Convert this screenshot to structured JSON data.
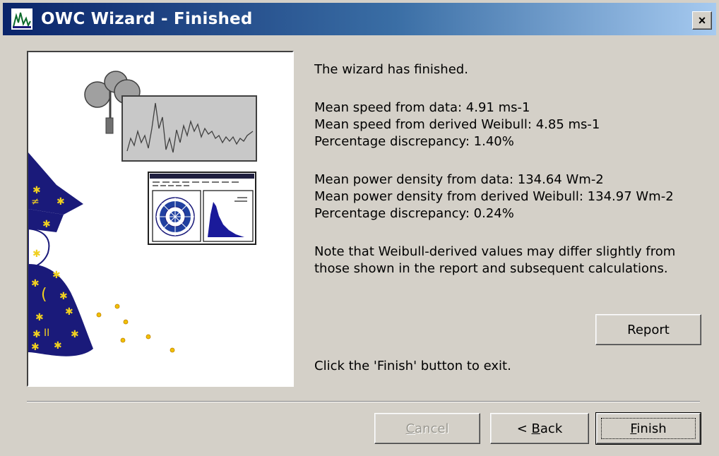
{
  "window": {
    "title": "OWC Wizard - Finished",
    "close_label": "×"
  },
  "content": {
    "intro": "The wizard has finished.",
    "speed_data": "Mean speed from data: 4.91 ms-1",
    "speed_weibull": "Mean speed from derived Weibull: 4.85 ms-1",
    "speed_discrepancy": "Percentage discrepancy: 1.40%",
    "power_data": "Mean power density from data: 134.64 Wm-2",
    "power_weibull": "Mean power density from derived Weibull: 134.97 Wm-2",
    "power_discrepancy": "Percentage discrepancy: 0.24%",
    "note_line1": "Note that Weibull-derived values may differ slightly from",
    "note_line2": "those shown in the report and subsequent calculations.",
    "finish_hint": "Click the 'Finish' button to exit."
  },
  "buttons": {
    "report": "Report",
    "cancel_accel": "C",
    "cancel_rest": "ancel",
    "back_prefix": "< ",
    "back_accel": "B",
    "back_rest": "ack",
    "finish_accel": "F",
    "finish_rest": "inish"
  },
  "colors": {
    "title_gradient_start": "#0a246a",
    "title_gradient_end": "#a6caf0",
    "dialog_face": "#d4d0c8",
    "wizard_robe": "#1a1a7a",
    "stars": "#f0d020"
  },
  "icons": {
    "app": "owc-chart-icon",
    "close": "close-icon",
    "illustration": "wizard-anemometer-illustration"
  }
}
